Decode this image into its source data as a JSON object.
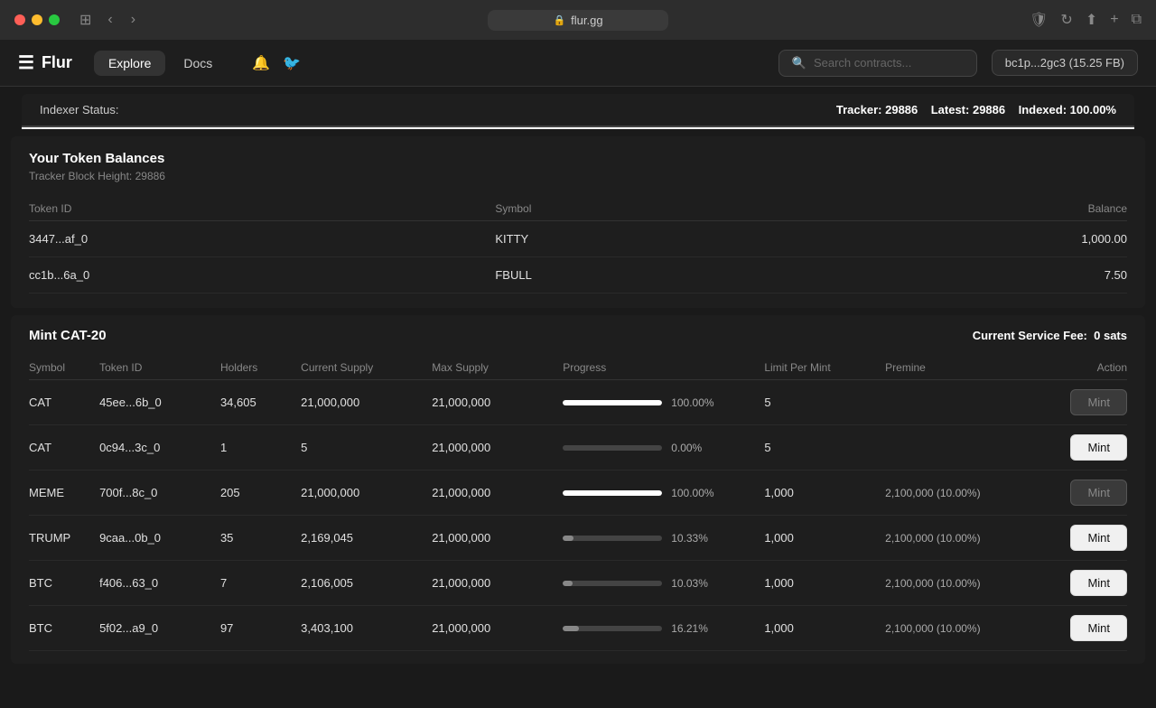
{
  "titleBar": {
    "url": "flur.gg",
    "lockIcon": "🔒"
  },
  "navBar": {
    "logoIcon": "≡",
    "logoText": "Flur",
    "tabs": [
      {
        "label": "Explore",
        "active": true
      },
      {
        "label": "Docs",
        "active": false
      }
    ],
    "bellIcon": "🔔",
    "twitterIcon": "𝕏",
    "searchPlaceholder": "Search contracts...",
    "walletText": "bc1p...2gc3  (15.25 FB)"
  },
  "indexer": {
    "label": "Indexer Status:",
    "trackerLabel": "Tracker:",
    "trackerValue": "29886",
    "latestLabel": "Latest:",
    "latestValue": "29886",
    "indexedLabel": "Indexed:",
    "indexedValue": "100.00%"
  },
  "tokenBalances": {
    "title": "Your Token Balances",
    "subtitle": "Tracker Block Height: 29886",
    "columns": {
      "tokenId": "Token ID",
      "symbol": "Symbol",
      "balance": "Balance"
    },
    "rows": [
      {
        "tokenId": "3447...af_0",
        "symbol": "KITTY",
        "balance": "1,000.00"
      },
      {
        "tokenId": "cc1b...6a_0",
        "symbol": "FBULL",
        "balance": "7.50"
      }
    ]
  },
  "mintCat20": {
    "title": "Mint CAT-20",
    "serviceFeeLabel": "Current Service Fee:",
    "serviceFeeValue": "0 sats",
    "columns": {
      "symbol": "Symbol",
      "tokenId": "Token ID",
      "holders": "Holders",
      "currentSupply": "Current Supply",
      "maxSupply": "Max Supply",
      "progress": "Progress",
      "limitPerMint": "Limit Per Mint",
      "premine": "Premine",
      "action": "Action"
    },
    "rows": [
      {
        "symbol": "CAT",
        "tokenId": "45ee...6b_0",
        "holders": "34,605",
        "currentSupply": "21,000,000",
        "maxSupply": "21,000,000",
        "progressPct": 100,
        "progressText": "100.00%",
        "limitPerMint": "5",
        "premine": "",
        "actionLabel": "Mint",
        "actionEnabled": false
      },
      {
        "symbol": "CAT",
        "tokenId": "0c94...3c_0",
        "holders": "1",
        "currentSupply": "5",
        "maxSupply": "21,000,000",
        "progressPct": 0,
        "progressText": "0.00%",
        "limitPerMint": "5",
        "premine": "",
        "actionLabel": "Mint",
        "actionEnabled": true
      },
      {
        "symbol": "MEME",
        "tokenId": "700f...8c_0",
        "holders": "205",
        "currentSupply": "21,000,000",
        "maxSupply": "21,000,000",
        "progressPct": 100,
        "progressText": "100.00%",
        "limitPerMint": "1,000",
        "premine": "2,100,000 (10.00%)",
        "actionLabel": "Mint",
        "actionEnabled": false
      },
      {
        "symbol": "TRUMP",
        "tokenId": "9caa...0b_0",
        "holders": "35",
        "currentSupply": "2,169,045",
        "maxSupply": "21,000,000",
        "progressPct": 10.33,
        "progressText": "10.33%",
        "limitPerMint": "1,000",
        "premine": "2,100,000 (10.00%)",
        "actionLabel": "Mint",
        "actionEnabled": true
      },
      {
        "symbol": "BTC",
        "tokenId": "f406...63_0",
        "holders": "7",
        "currentSupply": "2,106,005",
        "maxSupply": "21,000,000",
        "progressPct": 10.03,
        "progressText": "10.03%",
        "limitPerMint": "1,000",
        "premine": "2,100,000 (10.00%)",
        "actionLabel": "Mint",
        "actionEnabled": true
      },
      {
        "symbol": "BTC",
        "tokenId": "5f02...a9_0",
        "holders": "97",
        "currentSupply": "3,403,100",
        "maxSupply": "21,000,000",
        "progressPct": 16.21,
        "progressText": "16.21%",
        "limitPerMint": "1,000",
        "premine": "2,100,000 (10.00%)",
        "actionLabel": "Mint",
        "actionEnabled": true
      }
    ]
  }
}
